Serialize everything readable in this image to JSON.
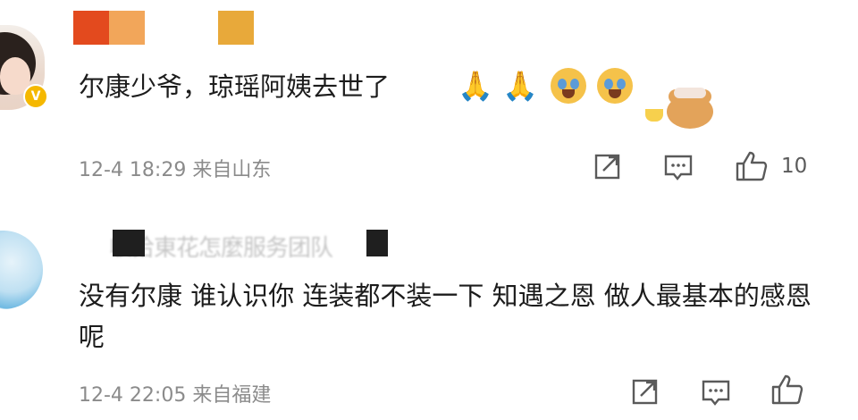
{
  "comments": [
    {
      "text": "尔康少爷，琼瑶阿姨去世了",
      "emojis": [
        "pray-emoji",
        "pray-emoji",
        "crying-face-emoji",
        "crying-face-emoji",
        "bear-sticker"
      ],
      "meta": "12-4 18:29 来自山东",
      "likes": "10"
    },
    {
      "text": "没有尔康 谁认识你 连装都不装一下 知遇之恩 做人最基本的感恩呢",
      "meta": "12-4 22:05 来自福建",
      "likes": ""
    }
  ],
  "colors": {
    "redact_red": "#e34a1e",
    "redact_orange": "#f2a65a",
    "redact_gold": "#e8a93a",
    "meta_text": "#8b8b8b",
    "vip_badge": "#f5b800"
  },
  "icons": [
    "share-icon",
    "comment-icon",
    "like-icon"
  ]
}
